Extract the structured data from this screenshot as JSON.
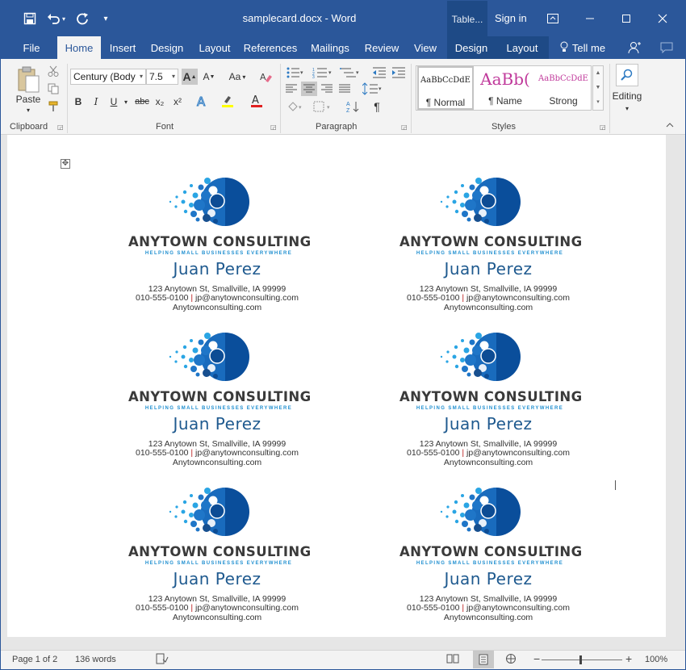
{
  "window": {
    "title": "samplecard.docx - Word",
    "context_tab": "Table...",
    "signin": "Sign in"
  },
  "qat": {
    "save": "save-icon",
    "undo": "undo-icon",
    "redo": "redo-icon",
    "customize": "customize-icon"
  },
  "tabs": [
    "File",
    "Home",
    "Insert",
    "Design",
    "Layout",
    "References",
    "Mailings",
    "Review",
    "View",
    "Design",
    "Layout",
    "Tell me"
  ],
  "ribbon": {
    "clipboard": {
      "label": "Clipboard",
      "paste": "Paste"
    },
    "font": {
      "label": "Font",
      "name": "Century (Body",
      "size": "7.5",
      "case": "Aa",
      "bold": "B",
      "italic": "I",
      "underline": "U",
      "strike": "abc",
      "sub": "x₂",
      "sup": "x²"
    },
    "paragraph": {
      "label": "Paragraph",
      "pilcrow": "¶"
    },
    "styles": {
      "label": "Styles",
      "items": [
        {
          "sample": "AaBbCcDdE",
          "name": "¶ Normal"
        },
        {
          "sample": "AaBb(",
          "name": "¶ Name"
        },
        {
          "sample": "AaBbCcDdE",
          "name": "Strong"
        }
      ]
    },
    "editing": {
      "label": "Editing"
    }
  },
  "colors": {
    "brand": "#2b579a",
    "logo_dark": "#0a4e9b",
    "logo_mid": "#1f76c8",
    "logo_light": "#2aa5e4",
    "name_color": "#1f5a8f",
    "tagline_color": "#1f8fd0",
    "style_name_pink": "#c0399b"
  },
  "cards": [
    {
      "company": "ANYTOWN CONSULTING",
      "tagline": "HELPING SMALL BUSINESSES EVERYWHERE",
      "name": "Juan Perez",
      "address": "123 Anytown St, Smallville, IA 99999",
      "phone": "010-555-0100",
      "sep": "|",
      "email": "jp@anytownconsulting.com",
      "web": "Anytownconsulting.com"
    },
    {
      "company": "ANYTOWN CONSULTING",
      "tagline": "HELPING SMALL BUSINESSES EVERYWHERE",
      "name": "Juan Perez",
      "address": "123 Anytown St, Smallville, IA 99999",
      "phone": "010-555-0100",
      "sep": "|",
      "email": "jp@anytownconsulting.com",
      "web": "Anytownconsulting.com"
    },
    {
      "company": "ANYTOWN CONSULTING",
      "tagline": "HELPING SMALL BUSINESSES EVERYWHERE",
      "name": "Juan Perez",
      "address": "123 Anytown St, Smallville, IA 99999",
      "phone": "010-555-0100",
      "sep": "|",
      "email": "jp@anytownconsulting.com",
      "web": "Anytownconsulting.com"
    },
    {
      "company": "ANYTOWN CONSULTING",
      "tagline": "HELPING SMALL BUSINESSES EVERYWHERE",
      "name": "Juan Perez",
      "address": "123 Anytown St, Smallville, IA 99999",
      "phone": "010-555-0100",
      "sep": "|",
      "email": "jp@anytownconsulting.com",
      "web": "Anytownconsulting.com"
    },
    {
      "company": "ANYTOWN CONSULTING",
      "tagline": "HELPING SMALL BUSINESSES EVERYWHERE",
      "name": "Juan Perez",
      "address": "123 Anytown St, Smallville, IA 99999",
      "phone": "010-555-0100",
      "sep": "|",
      "email": "jp@anytownconsulting.com",
      "web": "Anytownconsulting.com"
    },
    {
      "company": "ANYTOWN CONSULTING",
      "tagline": "HELPING SMALL BUSINESSES EVERYWHERE",
      "name": "Juan Perez",
      "address": "123 Anytown St, Smallville, IA 99999",
      "phone": "010-555-0100",
      "sep": "|",
      "email": "jp@anytownconsulting.com",
      "web": "Anytownconsulting.com"
    }
  ],
  "status": {
    "page": "Page 1 of 2",
    "words": "136 words",
    "zoom": "100%",
    "zoom_minus": "−",
    "zoom_plus": "+"
  }
}
